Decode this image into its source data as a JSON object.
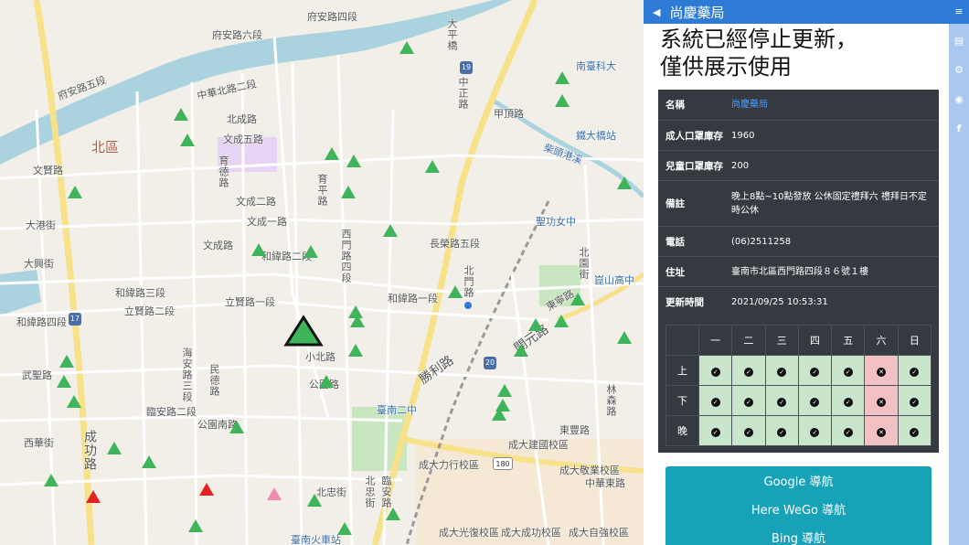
{
  "map": {
    "labels": [
      {
        "text": "府安路四段",
        "style": ""
      },
      {
        "text": "府安路五段",
        "style": ""
      },
      {
        "text": "府安路六段",
        "style": ""
      },
      {
        "text": "北區",
        "style": "district"
      },
      {
        "text": "中華北路二段",
        "style": ""
      },
      {
        "text": "北成路",
        "style": ""
      },
      {
        "text": "文成五路",
        "style": ""
      },
      {
        "text": "文成二路",
        "style": ""
      },
      {
        "text": "文成一路",
        "style": ""
      },
      {
        "text": "文成路",
        "style": ""
      },
      {
        "text": "文賢路",
        "style": ""
      },
      {
        "text": "大港街",
        "style": ""
      },
      {
        "text": "大興街",
        "style": ""
      },
      {
        "text": "和緯路四段",
        "style": ""
      },
      {
        "text": "和緯路三段",
        "style": ""
      },
      {
        "text": "和緯路二段",
        "style": ""
      },
      {
        "text": "和緯路一段",
        "style": ""
      },
      {
        "text": "立賢路一段",
        "style": ""
      },
      {
        "text": "立賢路二段",
        "style": ""
      },
      {
        "text": "長榮路五段",
        "style": ""
      },
      {
        "text": "小北路",
        "style": ""
      },
      {
        "text": "公園路",
        "style": ""
      },
      {
        "text": "公園南路",
        "style": ""
      },
      {
        "text": "臨安路二段",
        "style": ""
      },
      {
        "text": "成功路",
        "style": ""
      },
      {
        "text": "北忠街",
        "style": ""
      },
      {
        "text": "武聖路",
        "style": ""
      },
      {
        "text": "西華街",
        "style": ""
      },
      {
        "text": "民德路",
        "style": ""
      },
      {
        "text": "開元路",
        "style": ""
      },
      {
        "text": "勝利路",
        "style": ""
      },
      {
        "text": "東豐路",
        "style": ""
      },
      {
        "text": "東寧路",
        "style": ""
      },
      {
        "text": "中華東路",
        "style": ""
      },
      {
        "text": "成大建國校區",
        "style": ""
      },
      {
        "text": "成大力行校區",
        "style": ""
      },
      {
        "text": "成大敬業校區",
        "style": ""
      },
      {
        "text": "成大光復校區",
        "style": ""
      },
      {
        "text": "成大成功校區",
        "style": ""
      },
      {
        "text": "成大自強校區",
        "style": ""
      },
      {
        "text": "臺南二中",
        "style": ""
      },
      {
        "text": "聖功女中",
        "style": ""
      },
      {
        "text": "崑山高中",
        "style": ""
      },
      {
        "text": "南臺科大",
        "style": ""
      },
      {
        "text": "臺南火車站",
        "style": ""
      },
      {
        "text": "鐵大橋站",
        "style": ""
      },
      {
        "text": "甲頂路",
        "style": ""
      },
      {
        "text": "中正路",
        "style": ""
      },
      {
        "text": "大平橋",
        "style": ""
      },
      {
        "text": "海安路三段",
        "style": ""
      },
      {
        "text": "西門路四段",
        "style": ""
      },
      {
        "text": "北門路",
        "style": ""
      },
      {
        "text": "林森路",
        "style": ""
      },
      {
        "text": "北園街",
        "style": ""
      },
      {
        "text": "育德路",
        "style": ""
      },
      {
        "text": "育平路",
        "style": ""
      },
      {
        "text": "北忠街",
        "style": ""
      },
      {
        "text": "臨安路",
        "style": ""
      }
    ],
    "shields": [
      "19",
      "17",
      "20",
      "180"
    ],
    "highlight_label": "柴頭港溪"
  },
  "panel": {
    "back_icon": "caret-left-icon",
    "title": "尚慶藥局",
    "notice_line1": "系統已經停止更新，",
    "notice_line2": "僅供展示使用",
    "info": [
      {
        "key": "名稱",
        "value": "尚慶藥局",
        "link": true
      },
      {
        "key": "成人口罩庫存",
        "value": "1960",
        "link": false
      },
      {
        "key": "兒童口罩庫存",
        "value": "200",
        "link": false
      },
      {
        "key": "備註",
        "value": "晚上8點~10點發放 公休固定禮拜六 禮拜日不定時公休",
        "link": false
      },
      {
        "key": "電話",
        "value": "(06)2511258",
        "link": false
      },
      {
        "key": "住址",
        "value": "臺南市北區西門路四段８６號１樓",
        "link": false
      },
      {
        "key": "更新時間",
        "value": "2021/09/25 10:53:31",
        "link": false
      }
    ],
    "schedule": {
      "days": [
        "一",
        "二",
        "三",
        "四",
        "五",
        "六",
        "日"
      ],
      "rows": [
        {
          "label": "上",
          "status": [
            "open",
            "open",
            "open",
            "open",
            "open",
            "closed",
            "open"
          ]
        },
        {
          "label": "下",
          "status": [
            "open",
            "open",
            "open",
            "open",
            "open",
            "closed",
            "open"
          ]
        },
        {
          "label": "晚",
          "status": [
            "open",
            "open",
            "open",
            "open",
            "open",
            "closed",
            "open"
          ]
        }
      ],
      "open_color": "#c9e6cd",
      "closed_color": "#f1c1c6"
    },
    "nav_buttons": [
      "Google 導航",
      "Here WeGo 導航",
      "Bing 導航"
    ]
  },
  "toolbar": {
    "icons": [
      "menu-icon",
      "book-icon",
      "gear-icon",
      "github-icon",
      "facebook-icon"
    ],
    "menu_glyph": "≡",
    "book_glyph": "▤",
    "gear_glyph": "⚙",
    "github_glyph": "◉",
    "facebook_glyph": "f"
  },
  "colors": {
    "header_blue": "#2e7bd6",
    "marker_green": "#3fb45b",
    "marker_red": "#e32222",
    "marker_pink": "#f08bb0",
    "nav_teal": "#17a2b8",
    "table_dark": "#343a40"
  }
}
